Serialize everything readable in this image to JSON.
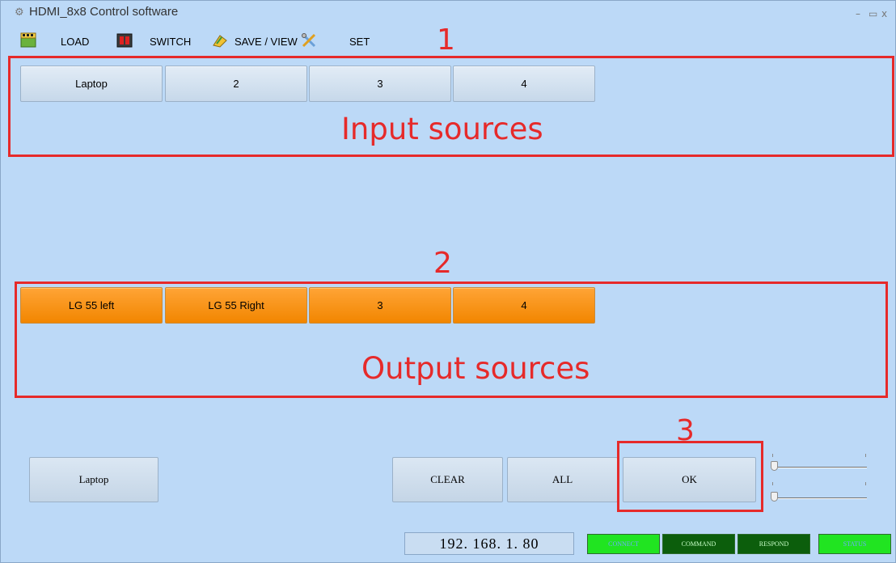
{
  "window": {
    "title": "HDMI_8x8 Control software",
    "minimize": "–",
    "maximize": "▭",
    "close": "x"
  },
  "toolbar": {
    "load": "LOAD",
    "switch": "SWITCH",
    "save_view": "SAVE / VIEW",
    "set": "SET"
  },
  "inputs": [
    "Laptop",
    "2",
    "3",
    "4"
  ],
  "outputs": [
    "LG 55 left",
    "LG 55 Right",
    "3",
    "4"
  ],
  "annotations": {
    "n1": "1",
    "input_label": "Input sources",
    "n2": "2",
    "output_label": "Output sources",
    "n3": "3"
  },
  "bottom": {
    "selected_input": "Laptop",
    "clear": "CLEAR",
    "all": "ALL",
    "ok": "OK",
    "ip": "192. 168. 1. 80"
  },
  "status": {
    "connect": "CONNECT",
    "command": "COMMAND",
    "respond": "RESPOND",
    "status": "STATUS"
  },
  "colors": {
    "background": "#bcd9f7",
    "output_button": "#f28600",
    "annotation": "#e62a2a",
    "status_bright": "#21e421",
    "status_dark": "#0c5e0c"
  },
  "sliders": [
    {
      "name": "slider-1",
      "level": 0
    },
    {
      "name": "slider-2",
      "level": 0
    }
  ]
}
